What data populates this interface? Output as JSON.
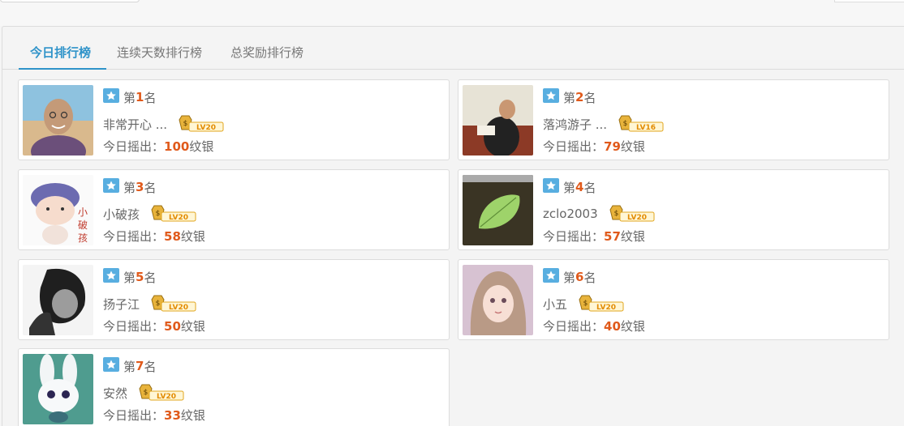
{
  "tabs": [
    {
      "label": "今日排行榜",
      "active": true
    },
    {
      "label": "连续天数排行榜",
      "active": false
    },
    {
      "label": "总奖励排行榜",
      "active": false
    }
  ],
  "rank_prefix": "第",
  "rank_suffix": "名",
  "earn_label": "今日摇出：",
  "earn_unit": "纹银",
  "colors": {
    "accent": "#2f93c9",
    "rank_highlight": "#e05a1b",
    "badge_gold": "#e8b33b"
  },
  "entries": [
    {
      "rank": "1",
      "name": "非常开心 ...",
      "level": "LV20",
      "amount": "100",
      "avatar": "elderly-man-beach"
    },
    {
      "rank": "2",
      "name": "落鸿游子 ...",
      "level": "LV16",
      "amount": "79",
      "avatar": "man-reading-chair"
    },
    {
      "rank": "3",
      "name": "小破孩",
      "level": "LV20",
      "amount": "58",
      "avatar": "cartoon-boy"
    },
    {
      "rank": "4",
      "name": "zclo2003",
      "level": "LV20",
      "amount": "57",
      "avatar": "green-leaf"
    },
    {
      "rank": "5",
      "name": "扬子江",
      "level": "LV20",
      "amount": "50",
      "avatar": "smoking-man-bw"
    },
    {
      "rank": "6",
      "name": "小五",
      "level": "LV20",
      "amount": "40",
      "avatar": "anime-girl"
    },
    {
      "rank": "7",
      "name": "安然",
      "level": "LV20",
      "amount": "33",
      "avatar": "white-rabbit"
    }
  ]
}
